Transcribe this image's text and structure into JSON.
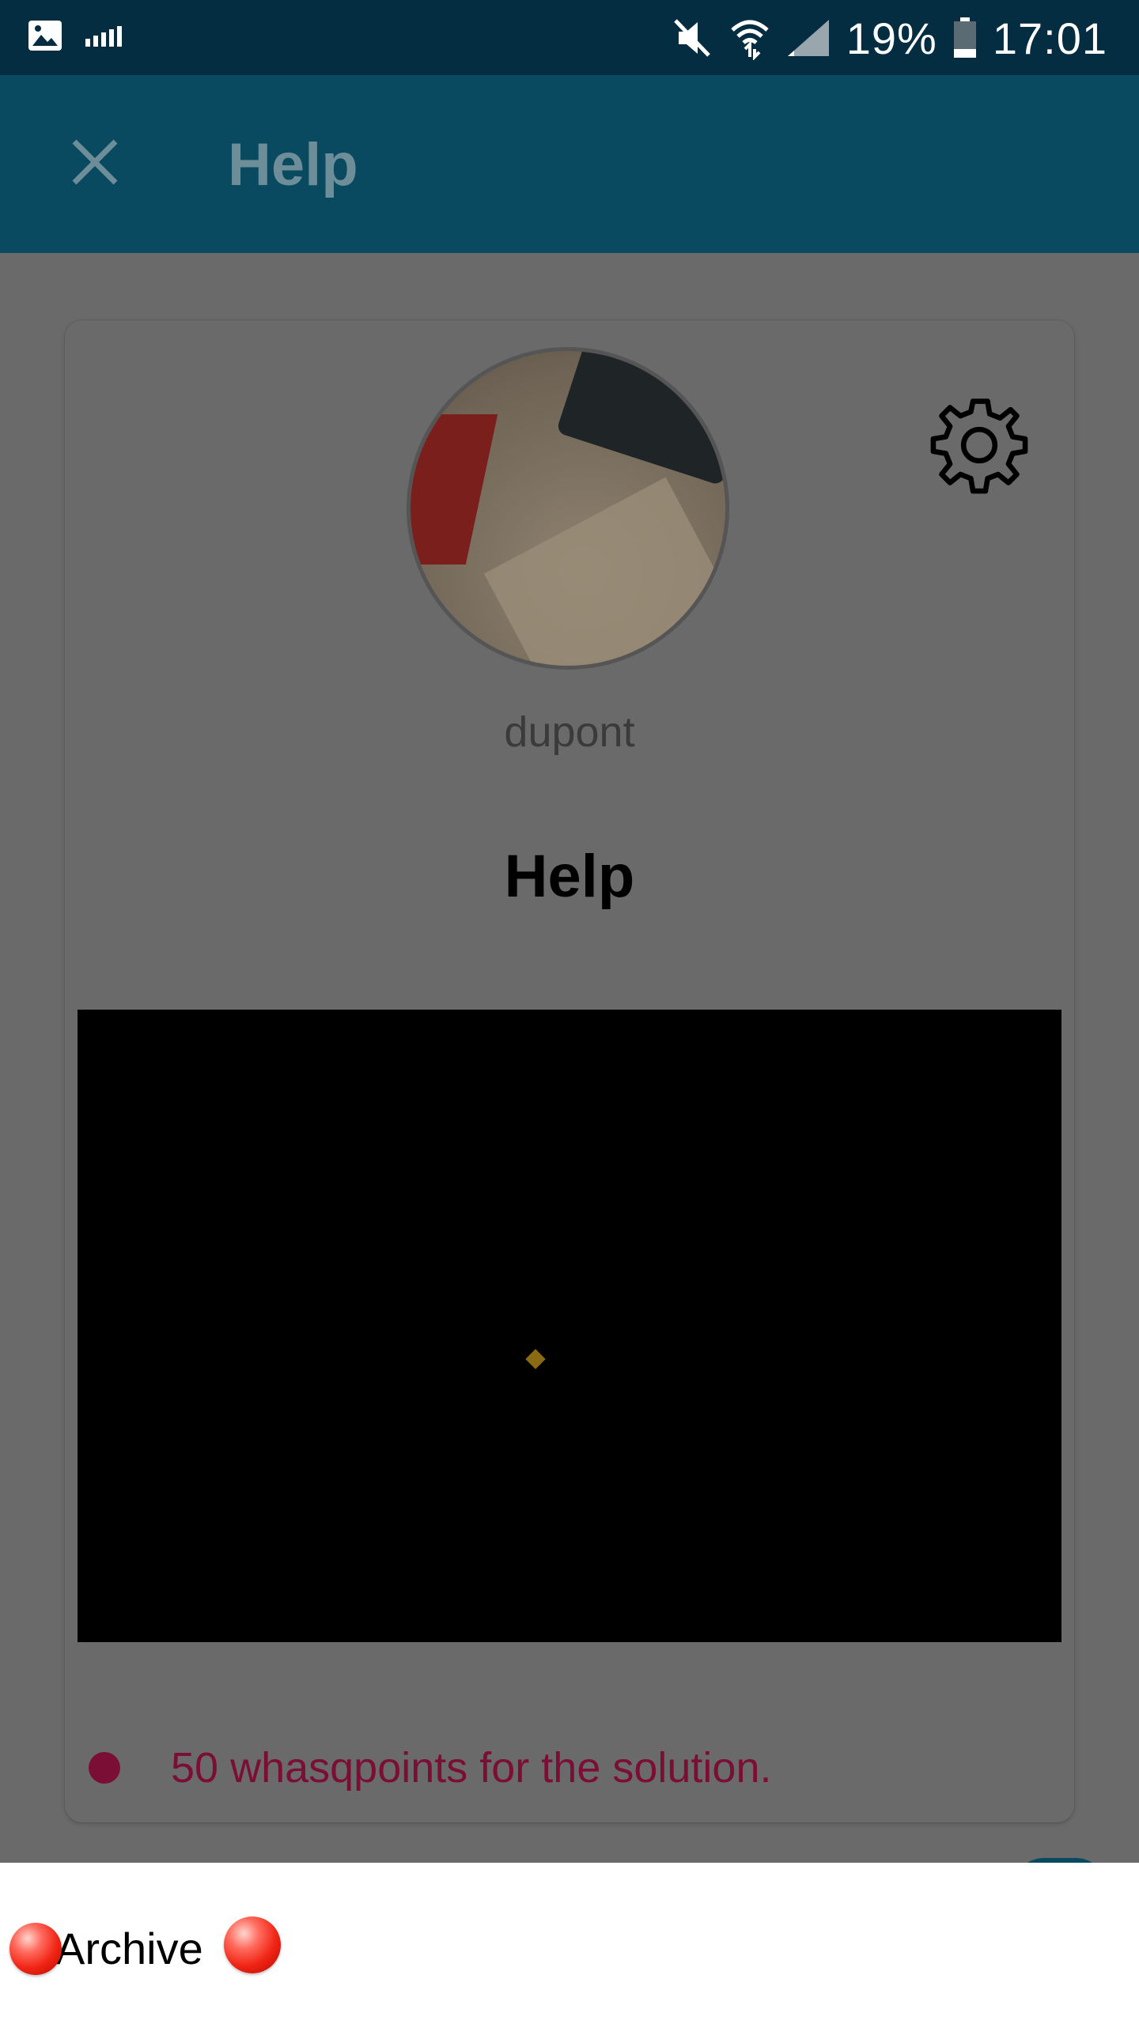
{
  "status_bar": {
    "battery": "19%",
    "time": "17:01",
    "icons": [
      "image-icon",
      "signal-bars-icon",
      "mute-icon",
      "wifi-icon",
      "cell-signal-icon",
      "battery-icon"
    ]
  },
  "app_bar": {
    "title": "Help",
    "close_icon": "close-icon"
  },
  "profile": {
    "username": "dupont",
    "settings_icon": "gear-icon"
  },
  "content": {
    "section_title": "Help",
    "reward_text": "50 whasqpoints for the solution."
  },
  "bottom_bar": {
    "label": "Archive"
  },
  "colors": {
    "status_bar": "#052d42",
    "app_bar": "#0a4a61",
    "overlay": "#6a6a6a",
    "reward": "#7b0e35"
  }
}
